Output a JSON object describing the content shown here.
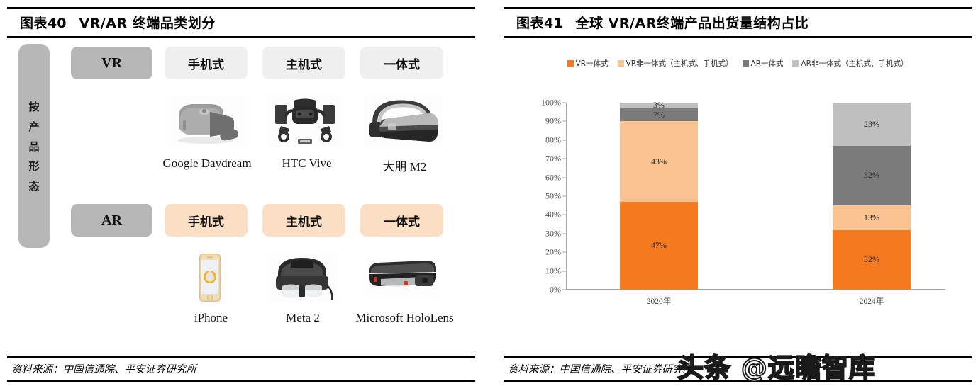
{
  "left_panel": {
    "figure_label": "图表",
    "figure_number": "40",
    "title": "VR/AR 终端品类划分",
    "source": "资料来源：中国信通院、平安证券研究所",
    "side_label_chars": [
      "按",
      "产",
      "品",
      "形",
      "态"
    ],
    "rows": [
      {
        "head": "VR",
        "categories": [
          "手机式",
          "主机式",
          "一体式"
        ],
        "products": [
          "Google Daydream",
          "HTC Vive",
          "大朋 M2"
        ]
      },
      {
        "head": "AR",
        "categories": [
          "手机式",
          "主机式",
          "一体式"
        ],
        "products": [
          "iPhone",
          "Meta 2",
          "Microsoft HoloLens"
        ]
      }
    ]
  },
  "right_panel": {
    "figure_label": "图表",
    "figure_number": "41",
    "title": "全球 VR/AR终端产品出货量结构占比",
    "source": "资料来源：中国信通院、平安证券研究所",
    "watermark": "头条 @远瞻智库"
  },
  "colors": {
    "vr_standalone": "#F4791F",
    "vr_tethered": "#F9C392",
    "ar_standalone": "#7B7B7B",
    "ar_tethered": "#BFBFBF",
    "chip_head": "#B7B7B7",
    "chip_vr": "#EFEFEF",
    "chip_ar": "#FADFC5"
  },
  "chart_data": {
    "type": "bar",
    "title": "全球 VR/AR终端产品出货量结构占比",
    "stacked": true,
    "stack_mode": "percent",
    "xlabel": "",
    "ylabel": "",
    "ylim": [
      0,
      100
    ],
    "yticks": [
      "0%",
      "10%",
      "20%",
      "30%",
      "40%",
      "50%",
      "60%",
      "70%",
      "80%",
      "90%",
      "100%"
    ],
    "grid": false,
    "legend_position": "top",
    "categories": [
      "2020年",
      "2024年"
    ],
    "series": [
      {
        "name": "VR一体式",
        "color": "#F4791F",
        "values": [
          47,
          32
        ],
        "labels": [
          "47%",
          "32%"
        ]
      },
      {
        "name": "VR非一体式（主机式、手机式）",
        "color": "#F9C392",
        "values": [
          43,
          13
        ],
        "labels": [
          "43%",
          "13%"
        ]
      },
      {
        "name": "AR一体式",
        "color": "#7B7B7B",
        "values": [
          7,
          32
        ],
        "labels": [
          "7%",
          "32%"
        ]
      },
      {
        "name": "AR非一体式（主机式、手机式）",
        "color": "#BFBFBF",
        "values": [
          3,
          23
        ],
        "labels": [
          "3%",
          "23%"
        ]
      }
    ]
  }
}
